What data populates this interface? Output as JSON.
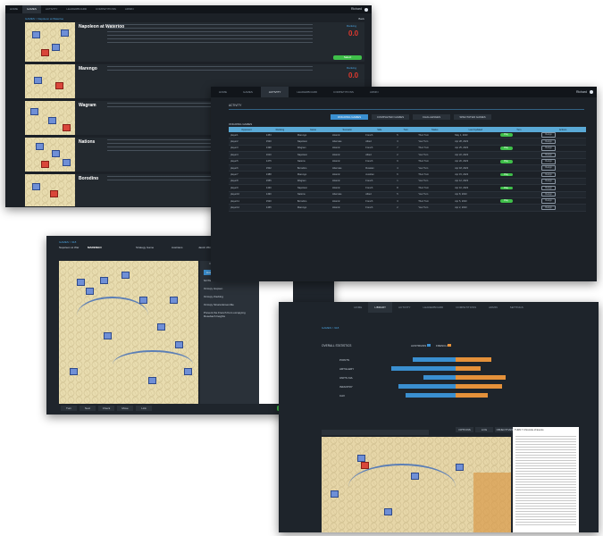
{
  "win1": {
    "tabs": [
      "HOME",
      "GAMES",
      "ACTIVITY",
      "LEADERBOARD",
      "COMPETITIONS",
      "ADMIN"
    ],
    "active_tab": 1,
    "user": "Richard",
    "breadcrumb": "GAMES > Napoleon at Waterloo",
    "back": "Back",
    "games": [
      {
        "title": "Napoleon at Waterloo",
        "rating_label": "Ranking",
        "rating": "0.0",
        "action": "Select"
      },
      {
        "title": "Marengo",
        "rating_label": "Ranking",
        "rating": "0.0",
        "action": ""
      },
      {
        "title": "Wagram",
        "rating_label": "",
        "rating": "",
        "action": ""
      },
      {
        "title": "Nations",
        "rating_label": "",
        "rating": "",
        "action": ""
      },
      {
        "title": "Borodino",
        "rating_label": "",
        "rating": "",
        "action": ""
      }
    ]
  },
  "win2": {
    "tabs": [
      "HOME",
      "GAMES",
      "ACTIVITY",
      "LEADERBOARD",
      "COMPETITIONS",
      "ADMIN"
    ],
    "active_tab": 2,
    "user": "Richard",
    "section": "ACTIVITY",
    "subtitle": "ONGOING GAMES",
    "filters": [
      "ONGOING GAMES",
      "COMPLETED GAMES",
      "CHALLENGES",
      "SPECTATED GAMES"
    ],
    "columns": [
      "Opponent",
      "Ranking",
      "Game",
      "Scenario",
      "Side",
      "Turn",
      "Status",
      "Last Updated",
      "Turn",
      "Actions"
    ],
    "rows": [
      [
        "player1",
        "1453",
        "Marengo",
        "Historic",
        "French",
        "5",
        "Their Turn",
        "May 1, 2023",
        "Play",
        "Resign"
      ],
      [
        "player2",
        "1520",
        "Napoleon",
        "Alternate",
        "Allied",
        "3",
        "Your Turn",
        "Apr 28, 2023",
        "",
        "Resign"
      ],
      [
        "player3",
        "1398",
        "Wagram",
        "Historic",
        "French",
        "7",
        "Their Turn",
        "Apr 25, 2023",
        "Play",
        "Resign"
      ],
      [
        "player4",
        "1610",
        "Napoleon",
        "Historic",
        "Allied",
        "2",
        "Your Turn",
        "Apr 22, 2023",
        "",
        "Resign"
      ],
      [
        "player5",
        "1475",
        "Nations",
        "Historic",
        "French",
        "9",
        "Their Turn",
        "Apr 20, 2023",
        "Play",
        "Resign"
      ],
      [
        "player6",
        "1502",
        "Borodino",
        "Alternate",
        "Russian",
        "4",
        "Your Turn",
        "Apr 18, 2023",
        "",
        "Resign"
      ],
      [
        "player7",
        "1388",
        "Marengo",
        "Historic",
        "Austrian",
        "6",
        "Their Turn",
        "Apr 15, 2023",
        "Play",
        "Resign"
      ],
      [
        "player8",
        "1555",
        "Wagram",
        "Historic",
        "French",
        "1",
        "Your Turn",
        "Apr 12, 2023",
        "",
        "Resign"
      ],
      [
        "player9",
        "1430",
        "Napoleon",
        "Historic",
        "French",
        "8",
        "Their Turn",
        "Apr 10, 2023",
        "Play",
        "Resign"
      ],
      [
        "player10",
        "1490",
        "Nations",
        "Alternate",
        "Allied",
        "5",
        "Your Turn",
        "Apr 8, 2023",
        "",
        "Resign"
      ],
      [
        "player11",
        "1520",
        "Borodino",
        "Historic",
        "French",
        "3",
        "Their Turn",
        "Apr 5, 2023",
        "Play",
        "Resign"
      ],
      [
        "player12",
        "1465",
        "Marengo",
        "Historic",
        "French",
        "2",
        "Your Turn",
        "Apr 2, 2023",
        "",
        "Resign"
      ]
    ]
  },
  "win3": {
    "breadcrumb": "GAMES > 918",
    "game_label": "Napoleon at War",
    "game_name": "MARENGO",
    "strategy": "Strategy Game",
    "side1": "Austrians",
    "side2": "Jacob Wimbeldon",
    "marks": "180 Marine Corps",
    "turn": "Oliver 378",
    "side3": "French",
    "mode_tabs": [
      "OPTIONS",
      "LOG",
      "OBJECTIVES"
    ],
    "panel_tabs": [
      "Austrians",
      "French"
    ],
    "panel_title": "TURN 7 Chronicle of Events",
    "log": [
      "NOTE: 75% chance on the French",
      "Occupy Hapsen",
      "Occupy Zoubing",
      "Occupy Sinara Ensemble",
      "Prevent the French from occupying Rosebach heights"
    ],
    "bottom_buttons": [
      "Turn",
      "Next",
      "Check",
      "Move",
      "Link"
    ],
    "confirm": "SUBMIT"
  },
  "win4": {
    "tabs": [
      "HOME",
      "LIBRARY",
      "ACTIVITY",
      "LEADERBOARD",
      "COMPETITIONS",
      "ADMIN",
      "SETTINGS"
    ],
    "active_tab": 1,
    "breadcrumb": "GAMES > 918",
    "stats_title": "OVERALL STATISTICS",
    "legend": [
      "AUSTRIANS",
      "FRENCH"
    ],
    "panel_title": "TURN 7 Chronicle of Events",
    "mode_tabs": [
      "OPTIONS",
      "LOG",
      "OBJECTIVES"
    ]
  },
  "chart_data": {
    "type": "bar",
    "categories": [
      "POINTS",
      "ARTILLERY",
      "UNITS KIA",
      "INFANTRY",
      "CAV"
    ],
    "series": [
      {
        "name": "AUSTRIANS",
        "values": [
          12,
          18,
          9,
          16,
          14
        ]
      },
      {
        "name": "FRENCH",
        "values": [
          10,
          7,
          14,
          13,
          9
        ]
      }
    ],
    "colors": [
      "#3a8fd0",
      "#e5913a"
    ]
  }
}
